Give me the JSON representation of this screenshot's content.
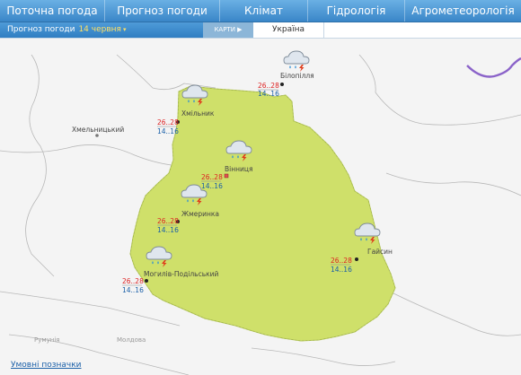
{
  "nav": {
    "items": [
      {
        "label": "Поточна погода"
      },
      {
        "label": "Прогноз погоди"
      },
      {
        "label": "Клімат"
      },
      {
        "label": "Гідрологія"
      },
      {
        "label": "Агрометеорологія"
      }
    ]
  },
  "subnav": {
    "forecast_label": "Прогноз погоди",
    "date_label": "14 червня",
    "maps_label": "КАРТИ",
    "region_label": "Україна"
  },
  "map": {
    "outside_labels": {
      "khmelnytskyi": "Хмельницький",
      "romania": "Румунія",
      "moldova": "Молдова"
    },
    "cities": [
      {
        "name": "Білопілля",
        "day": "26..28",
        "night": "14..16",
        "icon": "cloud-rain-thunder-icon"
      },
      {
        "name": "Хмільник",
        "day": "26..28",
        "night": "14..16",
        "icon": "cloud-rain-thunder-icon"
      },
      {
        "name": "Вінниця",
        "day": "26..28",
        "night": "14..16",
        "icon": "cloud-rain-thunder-icon"
      },
      {
        "name": "Жмеринка",
        "day": "26..28",
        "night": "14..16",
        "icon": "cloud-rain-thunder-icon"
      },
      {
        "name": "Гайсин",
        "day": "26..28",
        "night": "14..16",
        "icon": "cloud-rain-thunder-icon"
      },
      {
        "name": "Могилів-Подільський",
        "day": "26..28",
        "night": "14..16",
        "icon": "cloud-rain-thunder-icon"
      }
    ]
  },
  "legend_link": "Умовні позначки",
  "colors": {
    "region_fill": "#cfe06a",
    "temp_day": "#dd2222",
    "temp_night": "#1a5fa8",
    "nav_blue": "#3a86c8",
    "river": "#8b63c9"
  }
}
